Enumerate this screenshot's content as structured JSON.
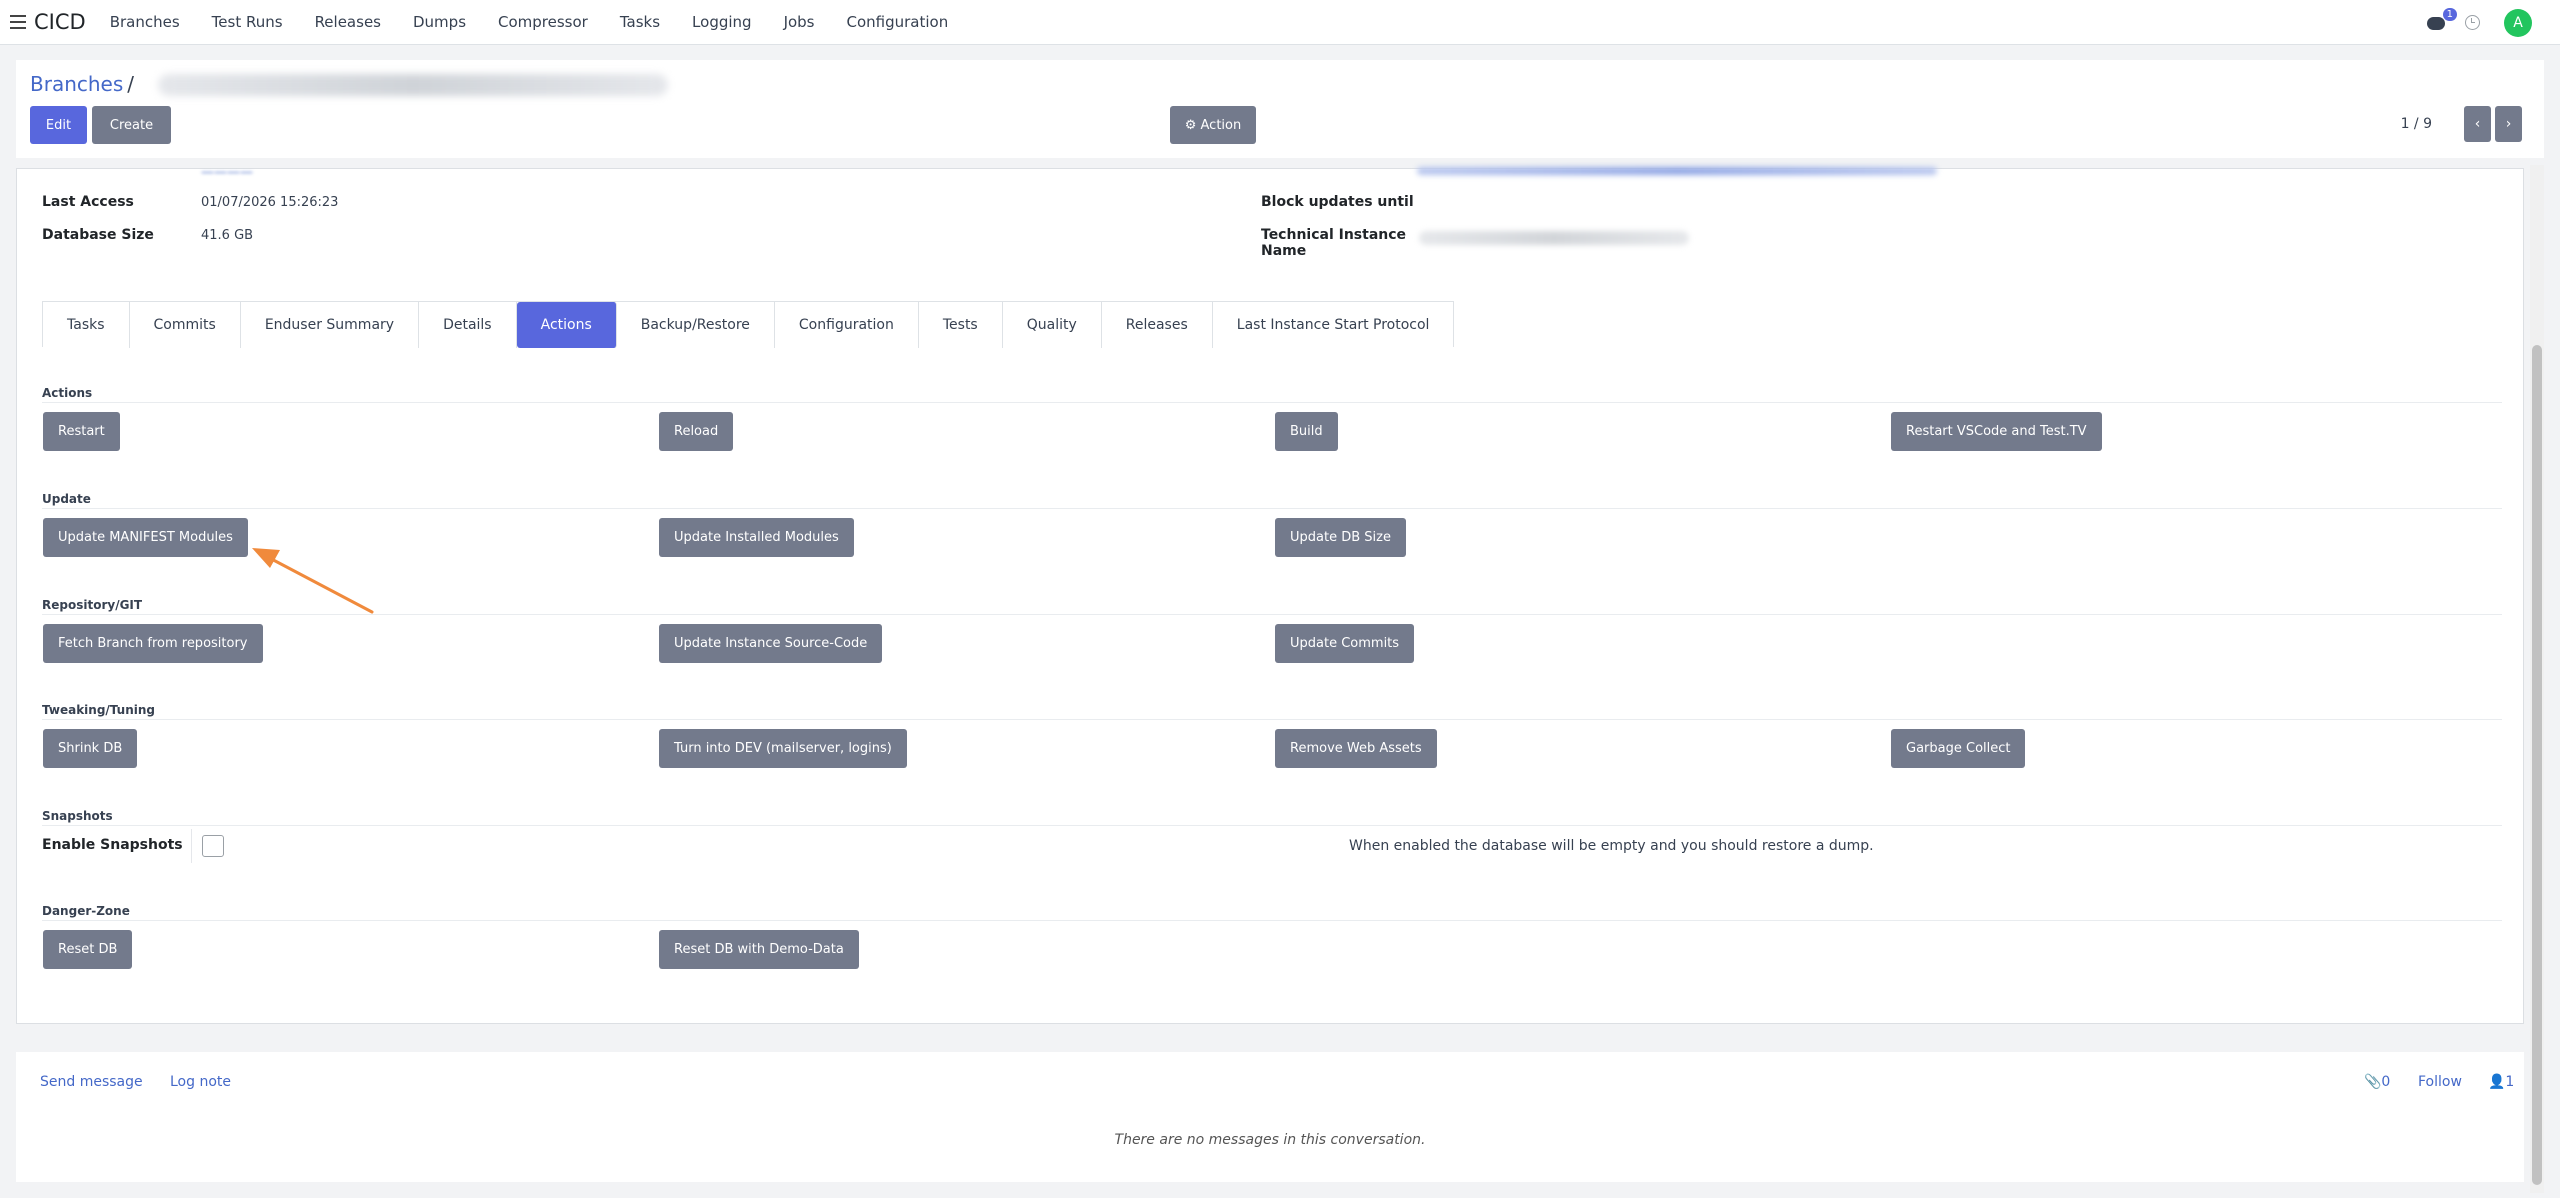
{
  "navbar": {
    "brand": "CICD",
    "menu": [
      "Branches",
      "Test Runs",
      "Releases",
      "Dumps",
      "Compressor",
      "Tasks",
      "Logging",
      "Jobs",
      "Configuration"
    ],
    "chat_badge": "1",
    "avatar_letter": "A"
  },
  "control": {
    "breadcrumb_link": "Branches",
    "breadcrumb_sep": "/",
    "edit_label": "Edit",
    "create_label": "Create",
    "action_label": "⚙ Action",
    "pager": "1 / 9",
    "prev_icon": "‹",
    "next_icon": "›"
  },
  "fields": {
    "last_access_label": "Last Access",
    "last_access_value": "01/07/2026 15:26:23",
    "db_size_label": "Database Size",
    "db_size_value": "41.6 GB",
    "block_updates_label": "Block updates until",
    "technical_name_label_1": "Technical Instance",
    "technical_name_label_2": "Name"
  },
  "tabs": [
    "Tasks",
    "Commits",
    "Enduser Summary",
    "Details",
    "Actions",
    "Backup/Restore",
    "Configuration",
    "Tests",
    "Quality",
    "Releases",
    "Last Instance Start Protocol"
  ],
  "active_tab": "Actions",
  "groups": {
    "actions": {
      "title": "Actions",
      "buttons": [
        "Restart",
        "Reload",
        "Build",
        "Restart VSCode and Test.TV"
      ]
    },
    "update": {
      "title": "Update",
      "buttons": [
        "Update MANIFEST Modules",
        "Update Installed Modules",
        "Update DB Size"
      ]
    },
    "git": {
      "title": "Repository/GIT",
      "buttons": [
        "Fetch Branch from repository",
        "Update Instance Source-Code",
        "Update Commits"
      ]
    },
    "tweak": {
      "title": "Tweaking/Tuning",
      "buttons": [
        "Shrink DB",
        "Turn into DEV (mailserver, logins)",
        "Remove Web Assets",
        "Garbage Collect"
      ]
    },
    "snapshots": {
      "title": "Snapshots",
      "label": "Enable Snapshots",
      "help": "When enabled the database will be empty and you should restore a dump."
    },
    "danger": {
      "title": "Danger-Zone",
      "buttons": [
        "Reset DB",
        "Reset DB with Demo-Data"
      ]
    }
  },
  "chatter": {
    "send_message": "Send message",
    "log_note": "Log note",
    "attachments": "📎0",
    "follow": "Follow",
    "followers": "👤1",
    "empty": "There are no messages in this conversation."
  },
  "colors": {
    "primary": "#5867dd",
    "secondary": "#737a8c",
    "link": "#4468c8",
    "arrow": "#f08a3c"
  }
}
